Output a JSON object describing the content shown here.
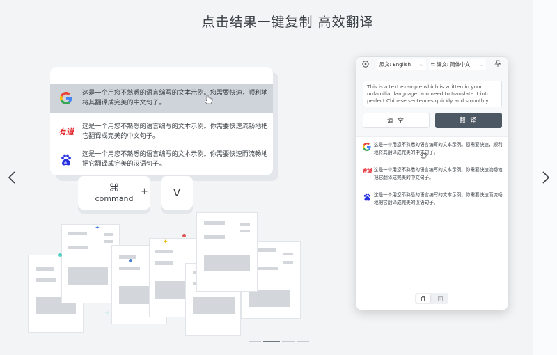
{
  "headline": "点击结果一键复制 高效翻译",
  "illustration": {
    "results": [
      {
        "icon": "google-icon",
        "text": "这是一个用您不熟悉的语言编写的文本示例。您需要快速，顺利地将其翻译成完美的中文句子。"
      },
      {
        "icon": "youdao-icon",
        "logo_text": "有道",
        "text": "这是一个用您不熟悉的语言编写的文本示例。你需要快速流畅地把它翻译成完美的中文句子。"
      },
      {
        "icon": "baidu-icon",
        "text": "这是一个用您不熟悉的语言编写的文本示例。你需要快速而流畅地把它翻译成完美的汉语句子。"
      }
    ],
    "shortcut": {
      "cmd_symbol": "⌘",
      "cmd_label": "command",
      "plus": "+",
      "v_label": "V"
    }
  },
  "app": {
    "source_lang": "原文: English",
    "target_lang": "译文: 简体中文",
    "swap_symbol": "⇆",
    "source_text": "This is a text example which is written in your unfamiliar language. You need to translate it into perfect Chinese sentences quickly and smoothly.",
    "clear_label": "清 空",
    "translate_label": "翻 译",
    "results": [
      {
        "icon": "google-icon",
        "text": "这是一个用您不熟悉的语言编写的文本示例。您需要快速，顺利地将其翻译成完美的中文句子。"
      },
      {
        "icon": "youdao-icon",
        "logo_text": "有道",
        "text": "这是一个用您不熟悉的语言编写的文本示例。你需要快速流畅地把它翻译成完美的中文句子。"
      },
      {
        "icon": "baidu-icon",
        "text": "这是一个用您不熟悉的语言编写的文本示例。你需要快速而流畅地把它翻译成完美的汉语句子。"
      }
    ]
  },
  "pager": {
    "count": 4,
    "active_index": 1
  },
  "colors": {
    "google_blue": "#4285F4",
    "google_red": "#EA4335",
    "google_yellow": "#FBBC05",
    "google_green": "#34A853",
    "youdao_red": "#e3242b",
    "baidu_blue": "#2932e1",
    "translate_button": "#4d5865"
  }
}
